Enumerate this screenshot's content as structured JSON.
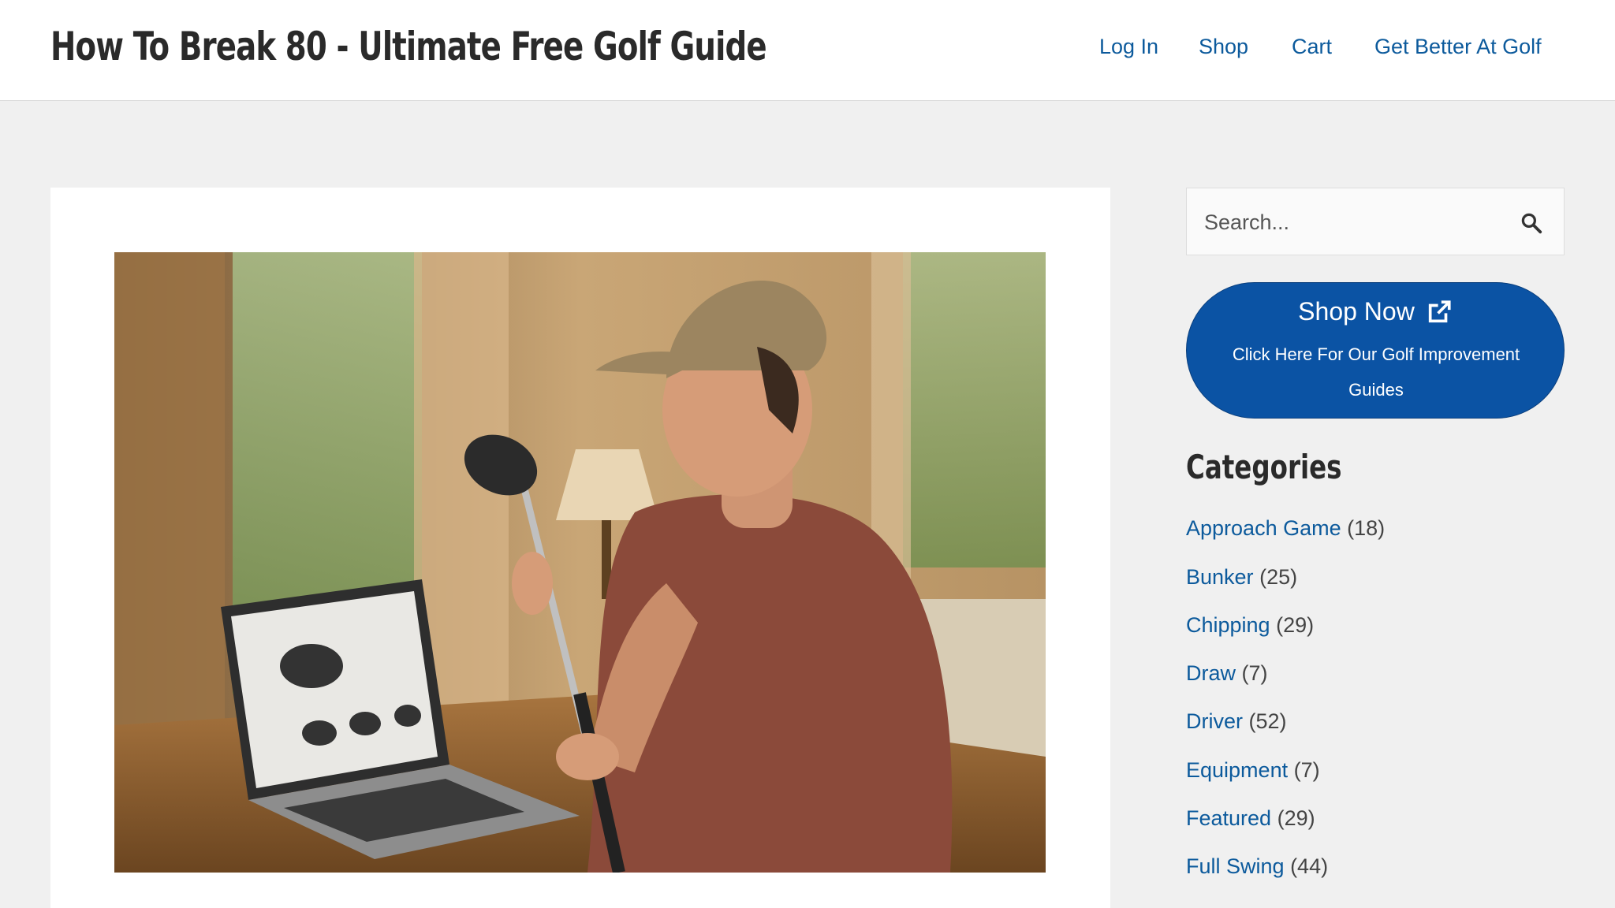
{
  "header": {
    "site_title": "How To Break 80 - Ultimate Free Golf Guide",
    "nav": [
      "Log In",
      "Shop",
      "Cart",
      "Get Better At Golf"
    ]
  },
  "search": {
    "placeholder": "Search..."
  },
  "shop_button": {
    "title": "Shop Now",
    "subtitle": "Click Here For Our Golf Improvement Guides"
  },
  "categories": {
    "heading": "Categories",
    "items": [
      {
        "name": "Approach Game",
        "count": "(18)"
      },
      {
        "name": "Bunker",
        "count": "(25)"
      },
      {
        "name": "Chipping",
        "count": "(29)"
      },
      {
        "name": "Draw",
        "count": "(7)"
      },
      {
        "name": "Driver",
        "count": "(52)"
      },
      {
        "name": "Equipment",
        "count": "(7)"
      },
      {
        "name": "Featured",
        "count": "(29)"
      },
      {
        "name": "Full Swing",
        "count": "(44)"
      }
    ]
  },
  "colors": {
    "link": "#0c5a9c",
    "button": "#0b53a4",
    "page_bg": "#f0f0f0"
  }
}
